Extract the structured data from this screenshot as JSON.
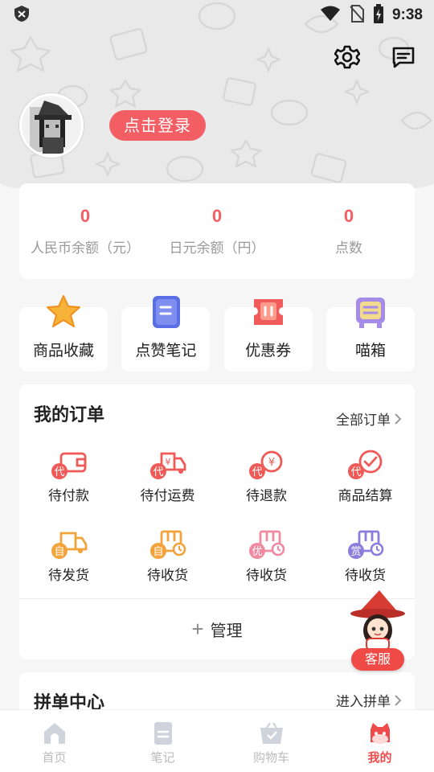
{
  "status_bar": {
    "time": "9:38"
  },
  "profile": {
    "login_label": "点击登录"
  },
  "balances": [
    {
      "value": "0",
      "label": "人民币余额（元）"
    },
    {
      "value": "0",
      "label": "日元余额（円）"
    },
    {
      "value": "0",
      "label": "点数"
    }
  ],
  "tiles": [
    {
      "label": "商品收藏",
      "icon": "star-icon"
    },
    {
      "label": "点赞笔记",
      "icon": "note-icon"
    },
    {
      "label": "优惠券",
      "icon": "coupon-icon"
    },
    {
      "label": "喵箱",
      "icon": "mail-box-icon"
    }
  ],
  "orders": {
    "title": "我的订单",
    "all_link": "全部订单",
    "items": [
      {
        "label": "待付款",
        "badge": "代"
      },
      {
        "label": "待付运费",
        "badge": "代"
      },
      {
        "label": "待退款",
        "badge": "代"
      },
      {
        "label": "商品结算",
        "badge": "代"
      },
      {
        "label": "待发货",
        "badge": "自"
      },
      {
        "label": "待收货",
        "badge": "自"
      },
      {
        "label": "待收货",
        "badge": "优"
      },
      {
        "label": "待收货",
        "badge": "赏"
      }
    ],
    "manage_plus": "+",
    "manage_label": "管理"
  },
  "group_buy": {
    "title": "拼单中心",
    "link": "进入拼单"
  },
  "service": {
    "label": "客服"
  },
  "nav": [
    {
      "label": "首页",
      "active": false
    },
    {
      "label": "笔记",
      "active": false
    },
    {
      "label": "购物车",
      "active": false
    },
    {
      "label": "我的",
      "active": true
    }
  ],
  "colors": {
    "accent": "#f35d64",
    "order_red": "#ef5a56",
    "order_orange": "#f3a33b",
    "order_pink": "#f08aa0",
    "order_purple": "#8c7ddc",
    "nav_active": "#f04b4b"
  }
}
